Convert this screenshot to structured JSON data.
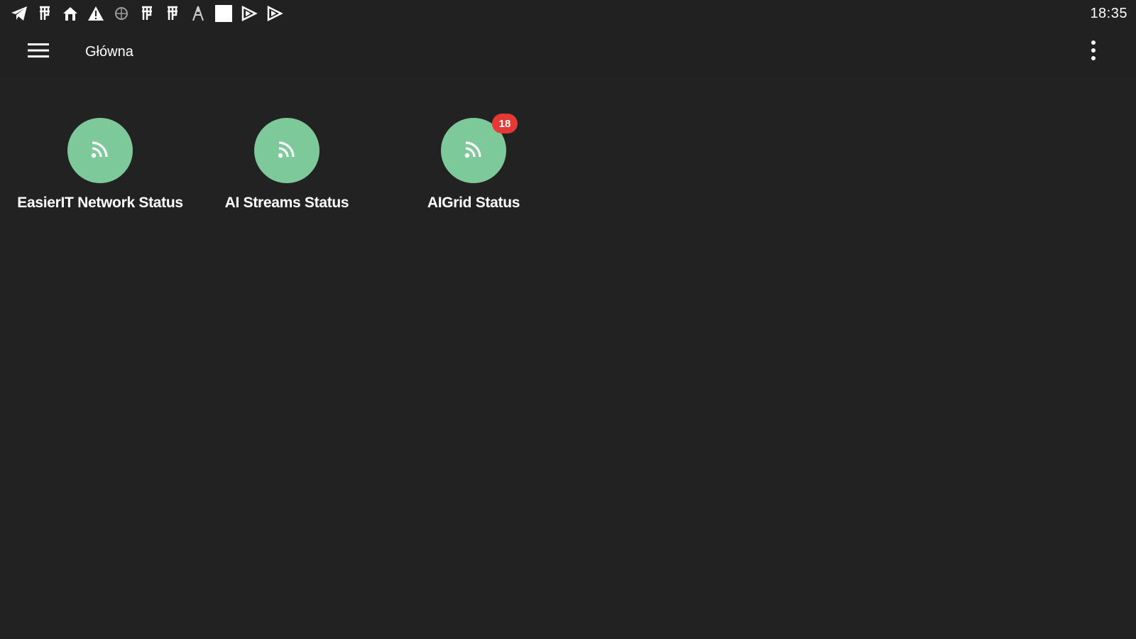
{
  "status_bar": {
    "icons": [
      "telegram-icon",
      "hp-icon",
      "home-icon",
      "warning-icon",
      "globe-icon",
      "hp-icon",
      "hp-icon",
      "tower-icon",
      "white-square-icon",
      "play-icon",
      "play-icon"
    ],
    "time": "18:35"
  },
  "toolbar": {
    "title": "Główna",
    "menu_icon": "hamburger-menu-icon",
    "overflow_icon": "more-vertical-icon"
  },
  "tiles": [
    {
      "label": "EasierIT Network Status",
      "icon": "rss-feed-icon",
      "badge": ""
    },
    {
      "label": "AI Streams Status",
      "icon": "rss-feed-icon",
      "badge": ""
    },
    {
      "label": "AIGrid Status",
      "icon": "rss-feed-icon",
      "badge": "18"
    }
  ],
  "colors": {
    "background": "#212121",
    "tile_accent": "#7ec99a",
    "badge": "#e53935",
    "text": "#ffffff"
  }
}
